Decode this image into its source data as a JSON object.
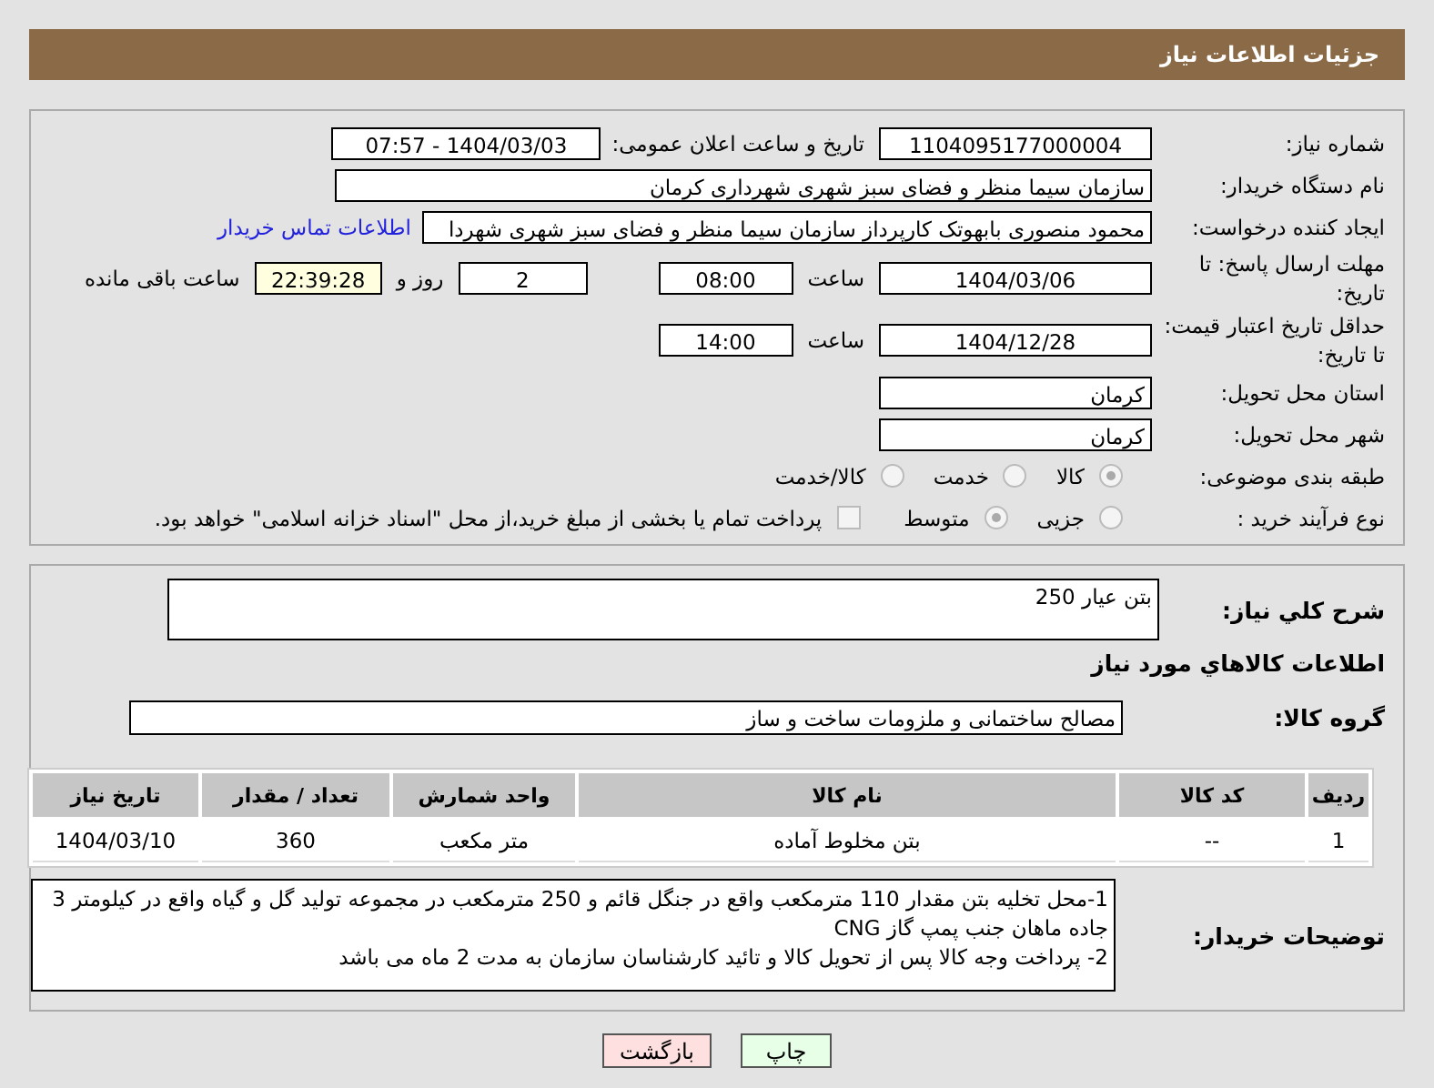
{
  "header": {
    "title": "جزئیات اطلاعات نیاز"
  },
  "need_number": {
    "label": "شماره نیاز:",
    "value": "1104095177000004"
  },
  "announce": {
    "label": "تاریخ و ساعت اعلان عمومی:",
    "value": "1404/03/03 - 07:57"
  },
  "buyer_org": {
    "label": "نام دستگاه خریدار:",
    "value": "سازمان سیما منظر و فضای سبز شهری شهرداری کرمان"
  },
  "requester": {
    "label": "ایجاد کننده درخواست:",
    "value": "محمود منصوری بابهوتک کارپرداز سازمان سیما منظر و فضای سبز شهری شهردا",
    "link": "اطلاعات تماس خریدار"
  },
  "reply_deadline": {
    "label": "مهلت ارسال پاسخ: تا تاریخ:",
    "date": "1404/03/06",
    "time_label": "ساعت",
    "time": "08:00",
    "days": "2",
    "days_label": "روز و",
    "remaining": "22:39:28",
    "remaining_label": "ساعت باقی مانده"
  },
  "price_validity": {
    "label": "حداقل تاریخ اعتبار قیمت: تا تاریخ:",
    "date": "1404/12/28",
    "time_label": "ساعت",
    "time": "14:00"
  },
  "province": {
    "label": "استان محل تحویل:",
    "value": "کرمان"
  },
  "city": {
    "label": "شهر محل تحویل:",
    "value": "کرمان"
  },
  "category": {
    "label": "طبقه بندی موضوعی:",
    "options": [
      {
        "label": "کالا",
        "selected": true
      },
      {
        "label": "خدمت",
        "selected": false
      },
      {
        "label": "کالا/خدمت",
        "selected": false
      }
    ]
  },
  "purchase_process": {
    "label": "نوع فرآیند خرید :",
    "options": [
      {
        "label": "جزیی",
        "selected": false
      },
      {
        "label": "متوسط",
        "selected": true
      }
    ],
    "treasury": {
      "checked": false,
      "label": "پرداخت تمام یا بخشی از مبلغ خرید،از محل \"اسناد خزانه اسلامی\" خواهد بود."
    }
  },
  "summary": {
    "label": "شرح کلي نیاز:",
    "value": "بتن عیار 250"
  },
  "goods_title": "اطلاعات کالاهاي مورد نیاز",
  "goods_group": {
    "label": "گروه کالا:",
    "value": "مصالح ساختمانی و ملزومات ساخت و ساز"
  },
  "table": {
    "columns": [
      "ردیف",
      "کد کالا",
      "نام کالا",
      "واحد شمارش",
      "تعداد / مقدار",
      "تاریخ نیاز"
    ],
    "rows": [
      [
        "1",
        "--",
        "بتن مخلوط آماده",
        "متر مکعب",
        "360",
        "1404/03/10"
      ]
    ]
  },
  "buyer_notes": {
    "label": "توضیحات خریدار:",
    "lines": [
      "1-محل تخلیه بتن مقدار 110 مترمکعب واقع در جنگل قائم و 250 مترمکعب در مجموعه تولید گل و گیاه واقع در کیلومتر 3 جاده ماهان جنب پمپ گاز CNG",
      "2- پرداخت وجه کالا پس از تحویل کالا و تائید کارشناسان سازمان به مدت 2 ماه می باشد"
    ]
  },
  "buttons": [
    {
      "label": "چاپ",
      "kind": "print"
    },
    {
      "label": "بازگشت",
      "kind": "back"
    }
  ]
}
